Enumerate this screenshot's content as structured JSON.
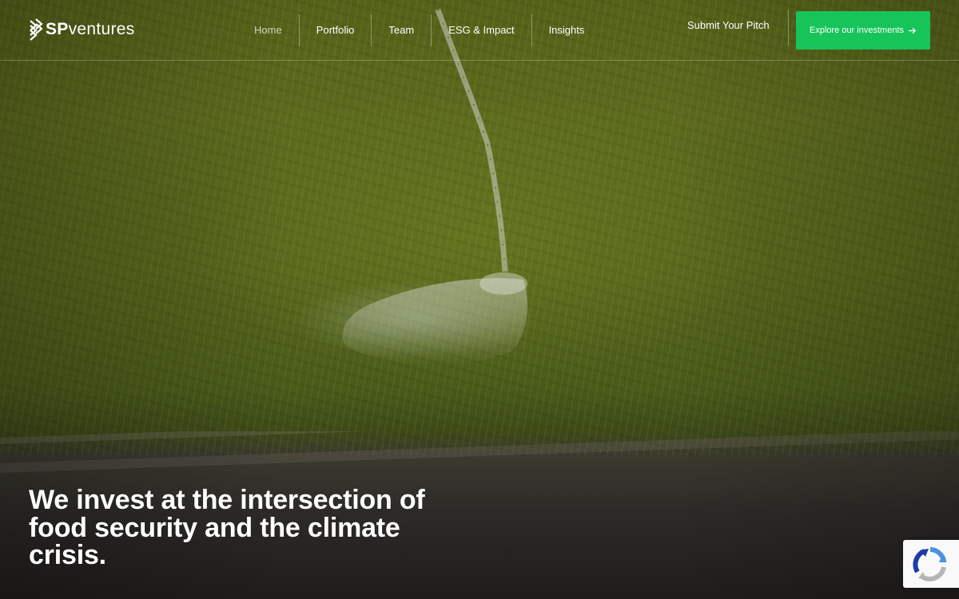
{
  "brand": {
    "logo_bold": "SP",
    "logo_regular": "ventures"
  },
  "nav": {
    "items": [
      {
        "label": "Home",
        "active": true
      },
      {
        "label": "Portfolio",
        "active": false
      },
      {
        "label": "Team",
        "active": false
      },
      {
        "label": "ESG & Impact",
        "active": false
      },
      {
        "label": "Insights",
        "active": false
      }
    ]
  },
  "header_actions": {
    "pitch_label": "Submit Your Pitch",
    "cta_label": "Explore our investments",
    "cta_icon": "arrow-right-icon"
  },
  "hero": {
    "headline": "We invest at the intersection of food security and the climate crisis."
  },
  "colors": {
    "accent": "#17c45a",
    "header_text": "#ffffff"
  },
  "icons": {
    "logo_mark": "stacked-chevrons-icon",
    "recaptcha": "recaptcha-icon"
  }
}
